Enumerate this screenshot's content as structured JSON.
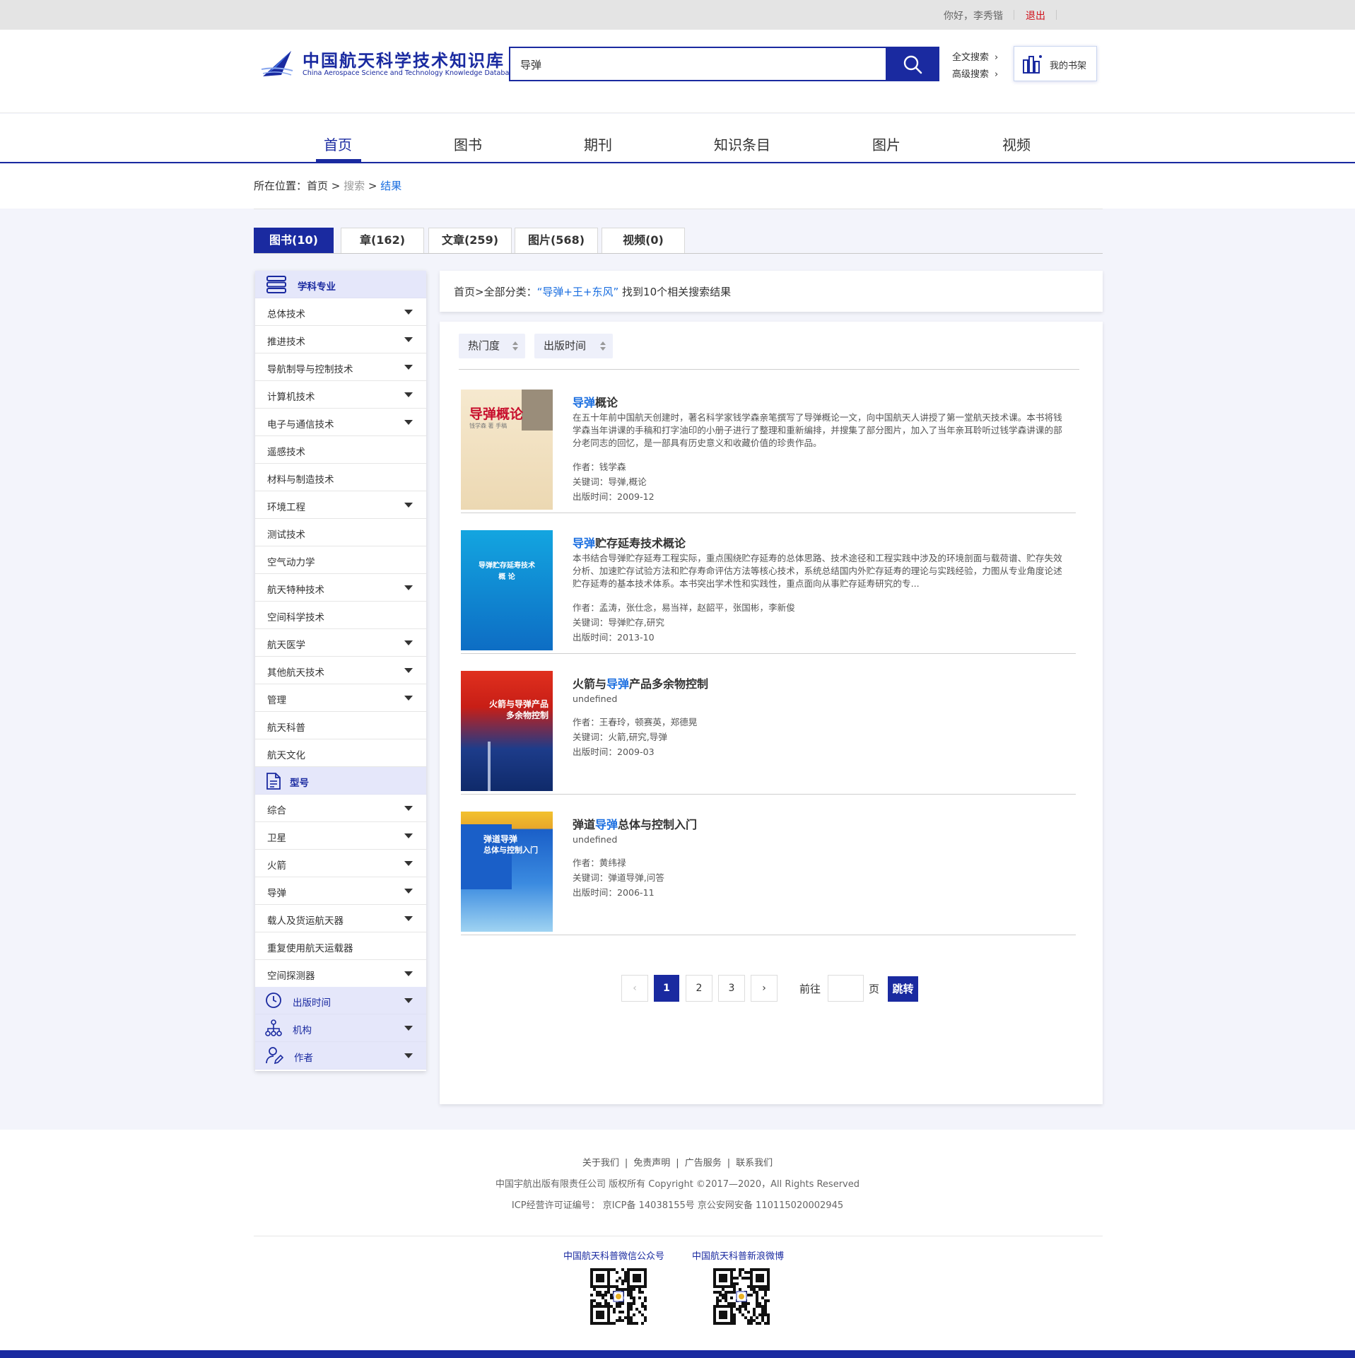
{
  "topbar": {
    "greeting": "你好，李秀锴",
    "logout": "退出"
  },
  "logo": {
    "cn": "中国航天科学技术知识库",
    "en": "China Aerospace Science and Technology Knowledge Database"
  },
  "search": {
    "value": "导弹"
  },
  "header_links": {
    "fulltext": "全文搜索",
    "advanced": "高级搜索",
    "chevron": "›",
    "bookshelf": "我的书架"
  },
  "nav": [
    "首页",
    "图书",
    "期刊",
    "知识条目",
    "图片",
    "视频"
  ],
  "breadcrumb": {
    "label": "所在位置：",
    "home": "首页",
    "sep": " > ",
    "search": "搜索",
    "result": "结果"
  },
  "tabs": [
    "图书(10)",
    "章(162)",
    "文章(259)",
    "图片(568)",
    "视频(0)"
  ],
  "sidebar": {
    "subject_title": "学科专业",
    "subjects": [
      "总体技术",
      "推进技术",
      "导航制导与控制技术",
      "计算机技术",
      "电子与通信技术",
      "遥感技术",
      "材料与制造技术",
      "环境工程",
      "测试技术",
      "空气动力学",
      "航天特种技术",
      "空间科学技术",
      "航天医学",
      "其他航天技术",
      "管理",
      "航天科普",
      "航天文化"
    ],
    "model_title": "型号",
    "models": [
      "综合",
      "卫星",
      "火箭",
      "导弹",
      "载人及货运航天器",
      "重复使用航天运载器",
      "空间探测器"
    ],
    "pub_time": "出版时间",
    "org": "机构",
    "author": "作者"
  },
  "summary": {
    "prefix": "首页>全部分类：",
    "query": "“导弹+王+东风”",
    "suffix": " 找到10个相关搜索结果"
  },
  "sort": {
    "hot": "热门度",
    "time": "出版时间"
  },
  "books": [
    {
      "title_kw": "导弹",
      "title_rest": "概论",
      "desc": "在五十年前中国航天创建时，著名科学家钱学森亲笔撰写了导弹概论一文，向中国航天人讲授了第一堂航天技术课。本书将钱学森当年讲课的手稿和打字油印的小册子进行了整理和重新编排，并搜集了部分图片，加入了当年亲耳聆听过钱学森讲课的部分老同志的回忆，是一部具有历史意义和收藏价值的珍贵作品。",
      "author": "作者：钱学森",
      "keywords": "关键词：导弹,概论",
      "date": "出版时间：2009-12",
      "cover_title": "导弹概论",
      "cover_sub": "钱学森 著   手稿"
    },
    {
      "title_kw": "导弹",
      "title_rest": "贮存延寿技术概论",
      "desc": "本书结合导弹贮存延寿工程实际，重点围绕贮存延寿的总体思路、技术途径和工程实践中涉及的环境剖面与载荷谱、贮存失效分析、加速贮存试验方法和贮存寿命评估方法等核心技术，系统总结国内外贮存延寿的理论与实践经验，力图从专业角度论述贮存延寿的基本技术体系。本书突出学术性和实践性，重点面向从事贮存延寿研究的专...",
      "author": "作者：孟涛，张仕念，易当祥，赵韶平，张国彬，李新俊",
      "keywords": "关键词：导弹贮存,研究",
      "date": "出版时间：2013-10",
      "cover_title": "导弹贮存延寿技术",
      "cover_sub": "概 论"
    },
    {
      "title_pre": "火箭与",
      "title_kw": "导弹",
      "title_rest": "产品多余物控制",
      "desc": "undefined",
      "author": "作者：王春玲，顿赛英，郑德晃",
      "keywords": "关键词：火箭,研究,导弹",
      "date": "出版时间：2009-03",
      "cover_title": "火箭与导弹产品",
      "cover_sub": "多余物控制"
    },
    {
      "title_pre": "弹道",
      "title_kw": "导弹",
      "title_rest": "总体与控制入门",
      "desc": "undefined",
      "author": "作者：黄纬禄",
      "keywords": "关键词：弹道导弹,问答",
      "date": "出版时间：2006-11",
      "cover_title": "弹道导弹",
      "cover_sub": "总体与控制入门"
    }
  ],
  "pagination": {
    "prev": "‹",
    "pages": [
      "1",
      "2",
      "3"
    ],
    "next": "›",
    "goto": "前往",
    "page": "页",
    "jump": "跳转"
  },
  "footer": {
    "links": [
      "关于我们",
      "免责声明",
      "广告服务",
      "联系我们"
    ],
    "copyright": "中国宇航出版有限责任公司 版权所有 Copyright ©2017—2020，All Rights Reserved",
    "icp": "ICP经营许可证编号： 京ICP备 14038155号 京公安网安备 110115020002945",
    "wechat": "中国航天科普微信公众号",
    "weibo": "中国航天科普新浪微博"
  },
  "colors": {
    "brand": "#1a2aa0",
    "link": "#1a6ee0",
    "logout": "#d0111b"
  }
}
